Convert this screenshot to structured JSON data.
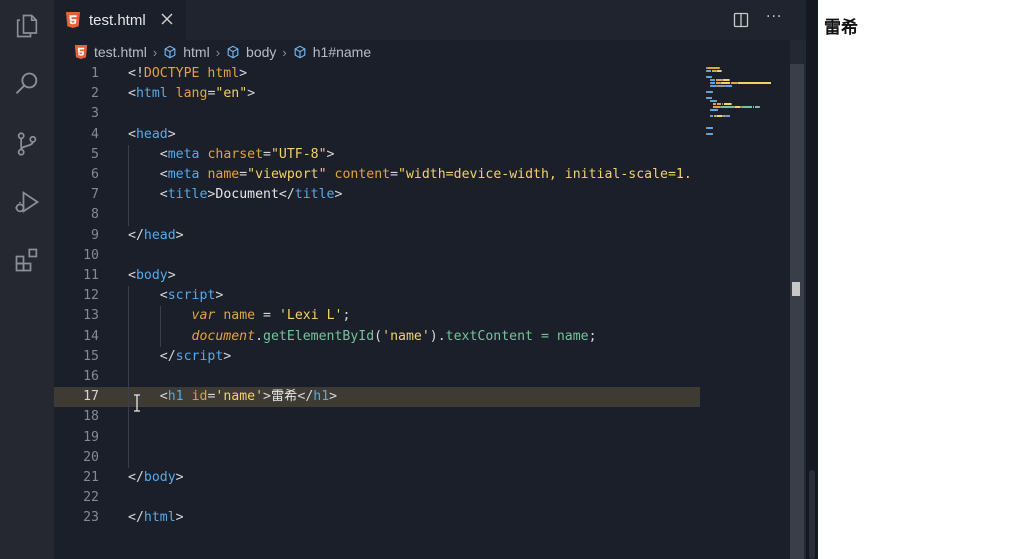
{
  "tab": {
    "label": "test.html"
  },
  "breadcrumb": [
    {
      "label": "test.html",
      "icon": "html5-icon"
    },
    {
      "label": "html",
      "icon": "element-cube-icon"
    },
    {
      "label": "body",
      "icon": "element-cube-icon"
    },
    {
      "label": "h1#name",
      "icon": "element-cube-icon"
    }
  ],
  "editor": {
    "current_line": 17,
    "lines": [
      {
        "n": "1",
        "tokens": [
          [
            "punc",
            "<!"
          ],
          [
            "doctype",
            "DOCTYPE html"
          ],
          [
            "punc",
            ">"
          ]
        ]
      },
      {
        "n": "2",
        "tokens": [
          [
            "punc",
            "<"
          ],
          [
            "tag",
            "html"
          ],
          [
            "text",
            " "
          ],
          [
            "attr",
            "lang"
          ],
          [
            "punc",
            "="
          ],
          [
            "str",
            "\"en\""
          ],
          [
            "punc",
            ">"
          ]
        ]
      },
      {
        "n": "3",
        "tokens": []
      },
      {
        "n": "4",
        "tokens": [
          [
            "punc",
            "<"
          ],
          [
            "tag",
            "head"
          ],
          [
            "punc",
            ">"
          ]
        ]
      },
      {
        "n": "5",
        "tokens": [
          [
            "text",
            "    "
          ],
          [
            "punc",
            "<"
          ],
          [
            "tag",
            "meta"
          ],
          [
            "text",
            " "
          ],
          [
            "attr",
            "charset"
          ],
          [
            "punc",
            "="
          ],
          [
            "str",
            "\"UTF-8\""
          ],
          [
            "punc",
            ">"
          ]
        ]
      },
      {
        "n": "6",
        "tokens": [
          [
            "text",
            "    "
          ],
          [
            "punc",
            "<"
          ],
          [
            "tag",
            "meta"
          ],
          [
            "text",
            " "
          ],
          [
            "attr",
            "name"
          ],
          [
            "punc",
            "="
          ],
          [
            "str",
            "\"viewport\""
          ],
          [
            "text",
            " "
          ],
          [
            "attr",
            "content"
          ],
          [
            "punc",
            "="
          ],
          [
            "str",
            "\"width=device-width, initial-scale=1."
          ]
        ]
      },
      {
        "n": "7",
        "tokens": [
          [
            "text",
            "    "
          ],
          [
            "punc",
            "<"
          ],
          [
            "tag",
            "title"
          ],
          [
            "punc",
            ">"
          ],
          [
            "text",
            "Document"
          ],
          [
            "punc",
            "</"
          ],
          [
            "tag",
            "title"
          ],
          [
            "punc",
            ">"
          ]
        ]
      },
      {
        "n": "8",
        "tokens": []
      },
      {
        "n": "9",
        "tokens": [
          [
            "punc",
            "</"
          ],
          [
            "tag",
            "head"
          ],
          [
            "punc",
            ">"
          ]
        ]
      },
      {
        "n": "10",
        "tokens": []
      },
      {
        "n": "11",
        "tokens": [
          [
            "punc",
            "<"
          ],
          [
            "tag",
            "body"
          ],
          [
            "punc",
            ">"
          ]
        ]
      },
      {
        "n": "12",
        "tokens": [
          [
            "text",
            "    "
          ],
          [
            "punc",
            "<"
          ],
          [
            "tag",
            "script"
          ],
          [
            "punc",
            ">"
          ]
        ]
      },
      {
        "n": "13",
        "tokens": [
          [
            "text",
            "        "
          ],
          [
            "kw",
            "var"
          ],
          [
            "text",
            " "
          ],
          [
            "attr",
            "name"
          ],
          [
            "text",
            " "
          ],
          [
            "punc",
            "="
          ],
          [
            "text",
            " "
          ],
          [
            "str",
            "'Lexi L'"
          ],
          [
            "punc",
            ";"
          ]
        ]
      },
      {
        "n": "14",
        "tokens": [
          [
            "text",
            "        "
          ],
          [
            "kw",
            "document"
          ],
          [
            "punc",
            "."
          ],
          [
            "fn",
            "getElementById"
          ],
          [
            "punc",
            "("
          ],
          [
            "str",
            "'name'"
          ],
          [
            "punc",
            ")."
          ],
          [
            "fn",
            "textContent"
          ],
          [
            "text",
            " "
          ],
          [
            "fn",
            "="
          ],
          [
            "text",
            " "
          ],
          [
            "fn",
            "name"
          ],
          [
            "punc",
            ";"
          ]
        ]
      },
      {
        "n": "15",
        "tokens": [
          [
            "text",
            "    "
          ],
          [
            "punc",
            "</"
          ],
          [
            "tag",
            "script"
          ],
          [
            "punc",
            ">"
          ]
        ]
      },
      {
        "n": "16",
        "tokens": []
      },
      {
        "n": "17",
        "tokens": [
          [
            "text",
            "    "
          ],
          [
            "punc",
            "<"
          ],
          [
            "tag",
            "h1"
          ],
          [
            "text",
            " "
          ],
          [
            "attr",
            "id"
          ],
          [
            "punc",
            "="
          ],
          [
            "str",
            "'name'"
          ],
          [
            "punc",
            ">"
          ],
          [
            "text",
            "雷希"
          ],
          [
            "punc",
            "</"
          ],
          [
            "tag",
            "h1"
          ],
          [
            "punc",
            ">"
          ]
        ]
      },
      {
        "n": "18",
        "tokens": []
      },
      {
        "n": "19",
        "tokens": []
      },
      {
        "n": "20",
        "tokens": []
      },
      {
        "n": "21",
        "tokens": [
          [
            "punc",
            "</"
          ],
          [
            "tag",
            "body"
          ],
          [
            "punc",
            ">"
          ]
        ]
      },
      {
        "n": "22",
        "tokens": []
      },
      {
        "n": "23",
        "tokens": [
          [
            "punc",
            "</"
          ],
          [
            "tag",
            "html"
          ],
          [
            "punc",
            ">"
          ]
        ]
      }
    ]
  },
  "preview": {
    "heading": "雷希"
  },
  "colors": {
    "tag": "#56a9e8",
    "attr": "#e0a341",
    "string": "#f1d16a",
    "function": "#76c39b",
    "editor_bg": "#1b1f2a",
    "current_line_bg": "#3d3b33"
  },
  "icons": {
    "activity_bar": [
      "explorer-icon",
      "search-icon",
      "source-control-icon",
      "run-debug-icon",
      "extensions-icon"
    ],
    "tab": "html5-icon",
    "tab_close": "close-icon",
    "editor_actions": [
      "split-editor-icon",
      "more-actions-icon"
    ]
  }
}
